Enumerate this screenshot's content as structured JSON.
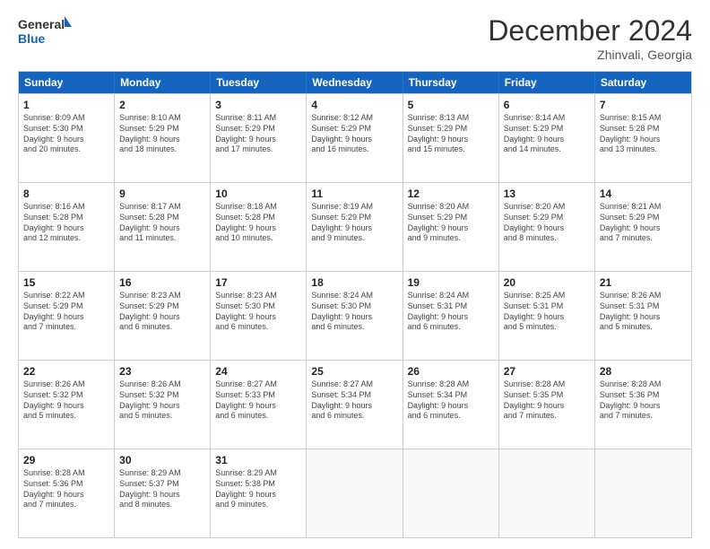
{
  "header": {
    "logo_line1": "General",
    "logo_line2": "Blue",
    "month_title": "December 2024",
    "subtitle": "Zhinvali, Georgia"
  },
  "weekdays": [
    "Sunday",
    "Monday",
    "Tuesday",
    "Wednesday",
    "Thursday",
    "Friday",
    "Saturday"
  ],
  "rows": [
    [
      {
        "day": "1",
        "lines": [
          "Sunrise: 8:09 AM",
          "Sunset: 5:30 PM",
          "Daylight: 9 hours",
          "and 20 minutes."
        ]
      },
      {
        "day": "2",
        "lines": [
          "Sunrise: 8:10 AM",
          "Sunset: 5:29 PM",
          "Daylight: 9 hours",
          "and 18 minutes."
        ]
      },
      {
        "day": "3",
        "lines": [
          "Sunrise: 8:11 AM",
          "Sunset: 5:29 PM",
          "Daylight: 9 hours",
          "and 17 minutes."
        ]
      },
      {
        "day": "4",
        "lines": [
          "Sunrise: 8:12 AM",
          "Sunset: 5:29 PM",
          "Daylight: 9 hours",
          "and 16 minutes."
        ]
      },
      {
        "day": "5",
        "lines": [
          "Sunrise: 8:13 AM",
          "Sunset: 5:29 PM",
          "Daylight: 9 hours",
          "and 15 minutes."
        ]
      },
      {
        "day": "6",
        "lines": [
          "Sunrise: 8:14 AM",
          "Sunset: 5:29 PM",
          "Daylight: 9 hours",
          "and 14 minutes."
        ]
      },
      {
        "day": "7",
        "lines": [
          "Sunrise: 8:15 AM",
          "Sunset: 5:28 PM",
          "Daylight: 9 hours",
          "and 13 minutes."
        ]
      }
    ],
    [
      {
        "day": "8",
        "lines": [
          "Sunrise: 8:16 AM",
          "Sunset: 5:28 PM",
          "Daylight: 9 hours",
          "and 12 minutes."
        ]
      },
      {
        "day": "9",
        "lines": [
          "Sunrise: 8:17 AM",
          "Sunset: 5:28 PM",
          "Daylight: 9 hours",
          "and 11 minutes."
        ]
      },
      {
        "day": "10",
        "lines": [
          "Sunrise: 8:18 AM",
          "Sunset: 5:28 PM",
          "Daylight: 9 hours",
          "and 10 minutes."
        ]
      },
      {
        "day": "11",
        "lines": [
          "Sunrise: 8:19 AM",
          "Sunset: 5:29 PM",
          "Daylight: 9 hours",
          "and 9 minutes."
        ]
      },
      {
        "day": "12",
        "lines": [
          "Sunrise: 8:20 AM",
          "Sunset: 5:29 PM",
          "Daylight: 9 hours",
          "and 9 minutes."
        ]
      },
      {
        "day": "13",
        "lines": [
          "Sunrise: 8:20 AM",
          "Sunset: 5:29 PM",
          "Daylight: 9 hours",
          "and 8 minutes."
        ]
      },
      {
        "day": "14",
        "lines": [
          "Sunrise: 8:21 AM",
          "Sunset: 5:29 PM",
          "Daylight: 9 hours",
          "and 7 minutes."
        ]
      }
    ],
    [
      {
        "day": "15",
        "lines": [
          "Sunrise: 8:22 AM",
          "Sunset: 5:29 PM",
          "Daylight: 9 hours",
          "and 7 minutes."
        ]
      },
      {
        "day": "16",
        "lines": [
          "Sunrise: 8:23 AM",
          "Sunset: 5:29 PM",
          "Daylight: 9 hours",
          "and 6 minutes."
        ]
      },
      {
        "day": "17",
        "lines": [
          "Sunrise: 8:23 AM",
          "Sunset: 5:30 PM",
          "Daylight: 9 hours",
          "and 6 minutes."
        ]
      },
      {
        "day": "18",
        "lines": [
          "Sunrise: 8:24 AM",
          "Sunset: 5:30 PM",
          "Daylight: 9 hours",
          "and 6 minutes."
        ]
      },
      {
        "day": "19",
        "lines": [
          "Sunrise: 8:24 AM",
          "Sunset: 5:31 PM",
          "Daylight: 9 hours",
          "and 6 minutes."
        ]
      },
      {
        "day": "20",
        "lines": [
          "Sunrise: 8:25 AM",
          "Sunset: 5:31 PM",
          "Daylight: 9 hours",
          "and 5 minutes."
        ]
      },
      {
        "day": "21",
        "lines": [
          "Sunrise: 8:26 AM",
          "Sunset: 5:31 PM",
          "Daylight: 9 hours",
          "and 5 minutes."
        ]
      }
    ],
    [
      {
        "day": "22",
        "lines": [
          "Sunrise: 8:26 AM",
          "Sunset: 5:32 PM",
          "Daylight: 9 hours",
          "and 5 minutes."
        ]
      },
      {
        "day": "23",
        "lines": [
          "Sunrise: 8:26 AM",
          "Sunset: 5:32 PM",
          "Daylight: 9 hours",
          "and 5 minutes."
        ]
      },
      {
        "day": "24",
        "lines": [
          "Sunrise: 8:27 AM",
          "Sunset: 5:33 PM",
          "Daylight: 9 hours",
          "and 6 minutes."
        ]
      },
      {
        "day": "25",
        "lines": [
          "Sunrise: 8:27 AM",
          "Sunset: 5:34 PM",
          "Daylight: 9 hours",
          "and 6 minutes."
        ]
      },
      {
        "day": "26",
        "lines": [
          "Sunrise: 8:28 AM",
          "Sunset: 5:34 PM",
          "Daylight: 9 hours",
          "and 6 minutes."
        ]
      },
      {
        "day": "27",
        "lines": [
          "Sunrise: 8:28 AM",
          "Sunset: 5:35 PM",
          "Daylight: 9 hours",
          "and 7 minutes."
        ]
      },
      {
        "day": "28",
        "lines": [
          "Sunrise: 8:28 AM",
          "Sunset: 5:36 PM",
          "Daylight: 9 hours",
          "and 7 minutes."
        ]
      }
    ],
    [
      {
        "day": "29",
        "lines": [
          "Sunrise: 8:28 AM",
          "Sunset: 5:36 PM",
          "Daylight: 9 hours",
          "and 7 minutes."
        ]
      },
      {
        "day": "30",
        "lines": [
          "Sunrise: 8:29 AM",
          "Sunset: 5:37 PM",
          "Daylight: 9 hours",
          "and 8 minutes."
        ]
      },
      {
        "day": "31",
        "lines": [
          "Sunrise: 8:29 AM",
          "Sunset: 5:38 PM",
          "Daylight: 9 hours",
          "and 9 minutes."
        ]
      },
      null,
      null,
      null,
      null
    ]
  ]
}
